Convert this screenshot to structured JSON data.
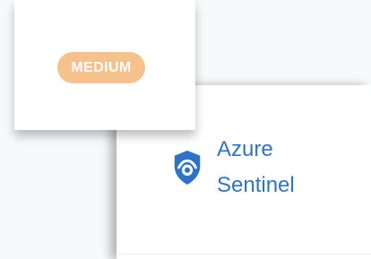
{
  "severity": {
    "label": "MEDIUM",
    "color": "#f6c18a"
  },
  "provider": {
    "name": "Azure Sentinel",
    "icon": "shield-eye-icon",
    "color": "#2f73c8"
  }
}
